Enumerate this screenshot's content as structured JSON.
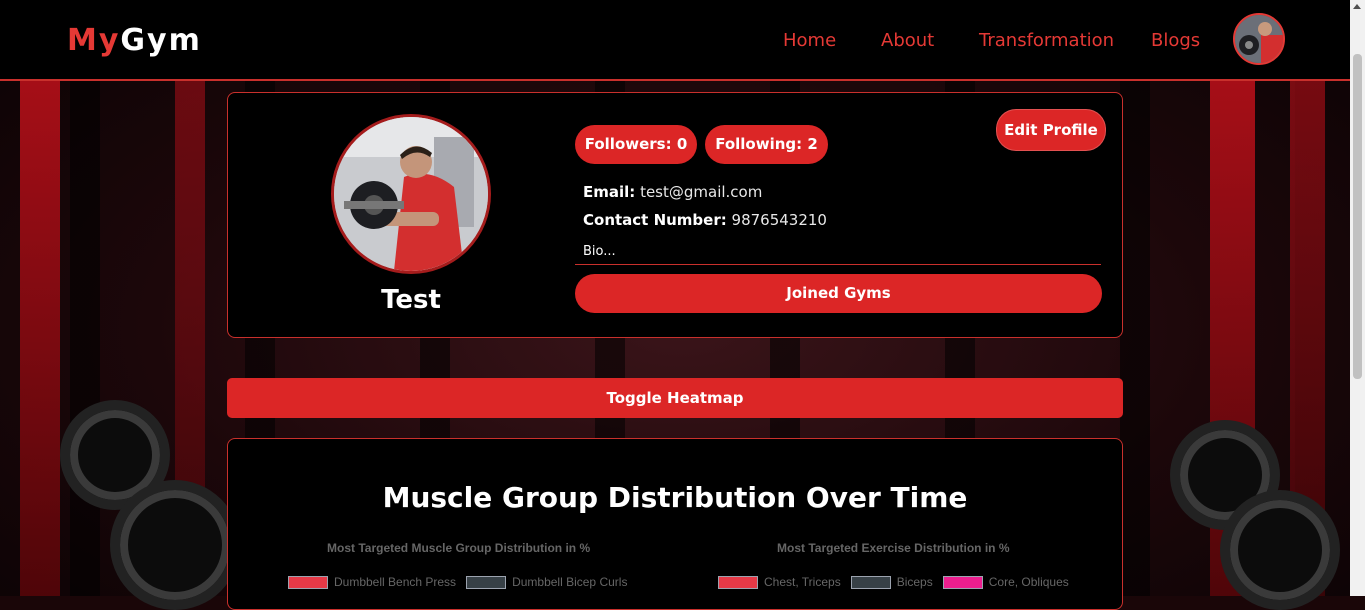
{
  "nav": {
    "logo_my": "My",
    "logo_gym": "Gym",
    "links": [
      "Home",
      "About",
      "Transformation",
      "Blogs"
    ]
  },
  "profile": {
    "username": "Test",
    "followers_label": "Followers: 0",
    "following_label": "Following: 2",
    "edit_label": "Edit Profile",
    "email_label": "Email:",
    "email_value": "test@gmail.com",
    "contact_label": "Contact Number:",
    "contact_value": "9876543210",
    "bio": "Bio...",
    "joined_label": "Joined Gyms"
  },
  "toggle_label": "Toggle Heatmap",
  "charts": {
    "title": "Muscle Group Distribution Over Time",
    "left": {
      "subtitle": "Most Targeted Muscle Group Distribution in %",
      "legend": [
        {
          "name": "Dumbbell Bench Press",
          "color": "#e53947"
        },
        {
          "name": "Dumbbell Bicep Curls",
          "color": "#374046"
        }
      ]
    },
    "right": {
      "subtitle": "Most Targeted Exercise Distribution in %",
      "legend": [
        {
          "name": "Chest, Triceps",
          "color": "#e53947"
        },
        {
          "name": "Biceps",
          "color": "#374046"
        },
        {
          "name": "Core, Obliques",
          "color": "#ec1e8e"
        }
      ]
    }
  },
  "colors": {
    "accent": "#dc2626",
    "nav_link": "#e53935",
    "border": "#c9302c"
  }
}
